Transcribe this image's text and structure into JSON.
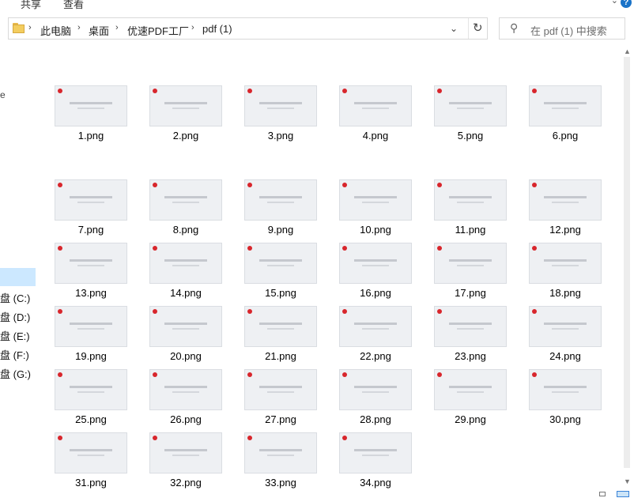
{
  "ribbon": {
    "tab_share": "共享",
    "tab_view": "查看",
    "help": "?"
  },
  "address": {
    "crumbs": [
      "此电脑",
      "桌面",
      "优速PDF工厂",
      "pdf (1)"
    ],
    "dropdown_icon": "chevron-down-icon",
    "refresh_icon": "refresh-icon"
  },
  "search": {
    "placeholder": "在 pdf (1) 中搜索",
    "icon": "search-icon"
  },
  "nav": {
    "partial_top": "e",
    "drives": [
      "盘 (C:)",
      "盘 (D:)",
      "盘 (E:)",
      "盘 (F:)",
      "盘 (G:)"
    ]
  },
  "files": [
    "1.png",
    "2.png",
    "3.png",
    "4.png",
    "5.png",
    "6.png",
    "7.png",
    "8.png",
    "9.png",
    "10.png",
    "11.png",
    "12.png",
    "13.png",
    "14.png",
    "15.png",
    "16.png",
    "17.png",
    "18.png",
    "19.png",
    "20.png",
    "21.png",
    "22.png",
    "23.png",
    "24.png",
    "25.png",
    "26.png",
    "27.png",
    "28.png",
    "29.png",
    "30.png",
    "31.png",
    "32.png",
    "33.png",
    "34.png"
  ],
  "colors": {
    "accent_red": "#d8262c",
    "selection": "#cce8ff",
    "slide_bg": "#eef0f3"
  }
}
